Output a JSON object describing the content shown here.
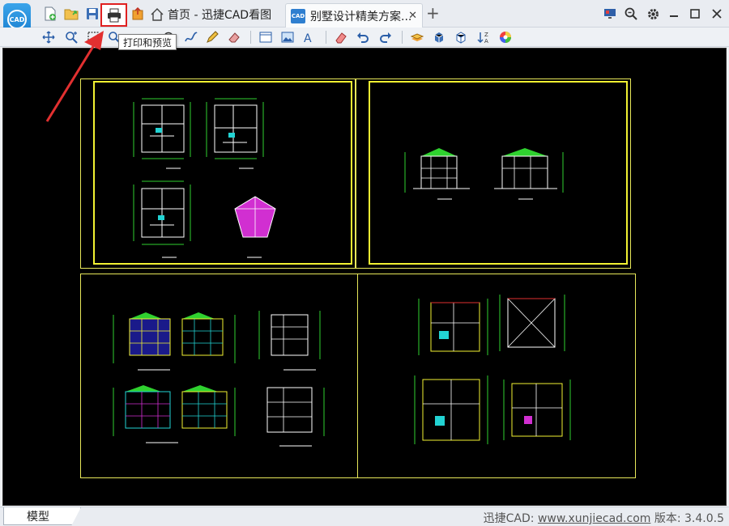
{
  "app": {
    "logo_text": "CAD"
  },
  "tabs": {
    "home_label": "首页 - 迅捷CAD看图",
    "doc_label": "别墅设计精美方案...",
    "doc_icon_text": "CAD"
  },
  "tooltip": {
    "text": "打印和预览"
  },
  "statusbar": {
    "model_tab": "模型",
    "brand_prefix": "迅捷CAD: ",
    "url": "www.xunjiecad.com",
    "version_label": " 版本: 3.4.0.5"
  },
  "colors": {
    "accent": "#1a7fcf",
    "highlight": "#e02020",
    "canvas_bg": "#000000",
    "frame_yellow": "#f2f232",
    "cad_cyan": "#22d3d3",
    "cad_magenta": "#d12fd1",
    "cad_green": "#2fd12f"
  },
  "icons": {
    "quick": [
      "new-file-icon",
      "open-folder-icon",
      "save-icon",
      "print-icon",
      "export-icon"
    ],
    "tools": [
      "pan-icon",
      "zoom-window-icon",
      "select-box-icon",
      "zoom-icon",
      "measure-icon",
      "polyline-icon",
      "pen-icon",
      "eraser-icon",
      "undo-icon",
      "redo-icon",
      "layer-icon",
      "box-3d-icon",
      "cube-icon",
      "sort-icon",
      "color-wheel-icon"
    ],
    "window": [
      "screen-icon",
      "search-icon",
      "gear-icon",
      "minimize-icon",
      "maximize-icon",
      "close-icon"
    ]
  }
}
